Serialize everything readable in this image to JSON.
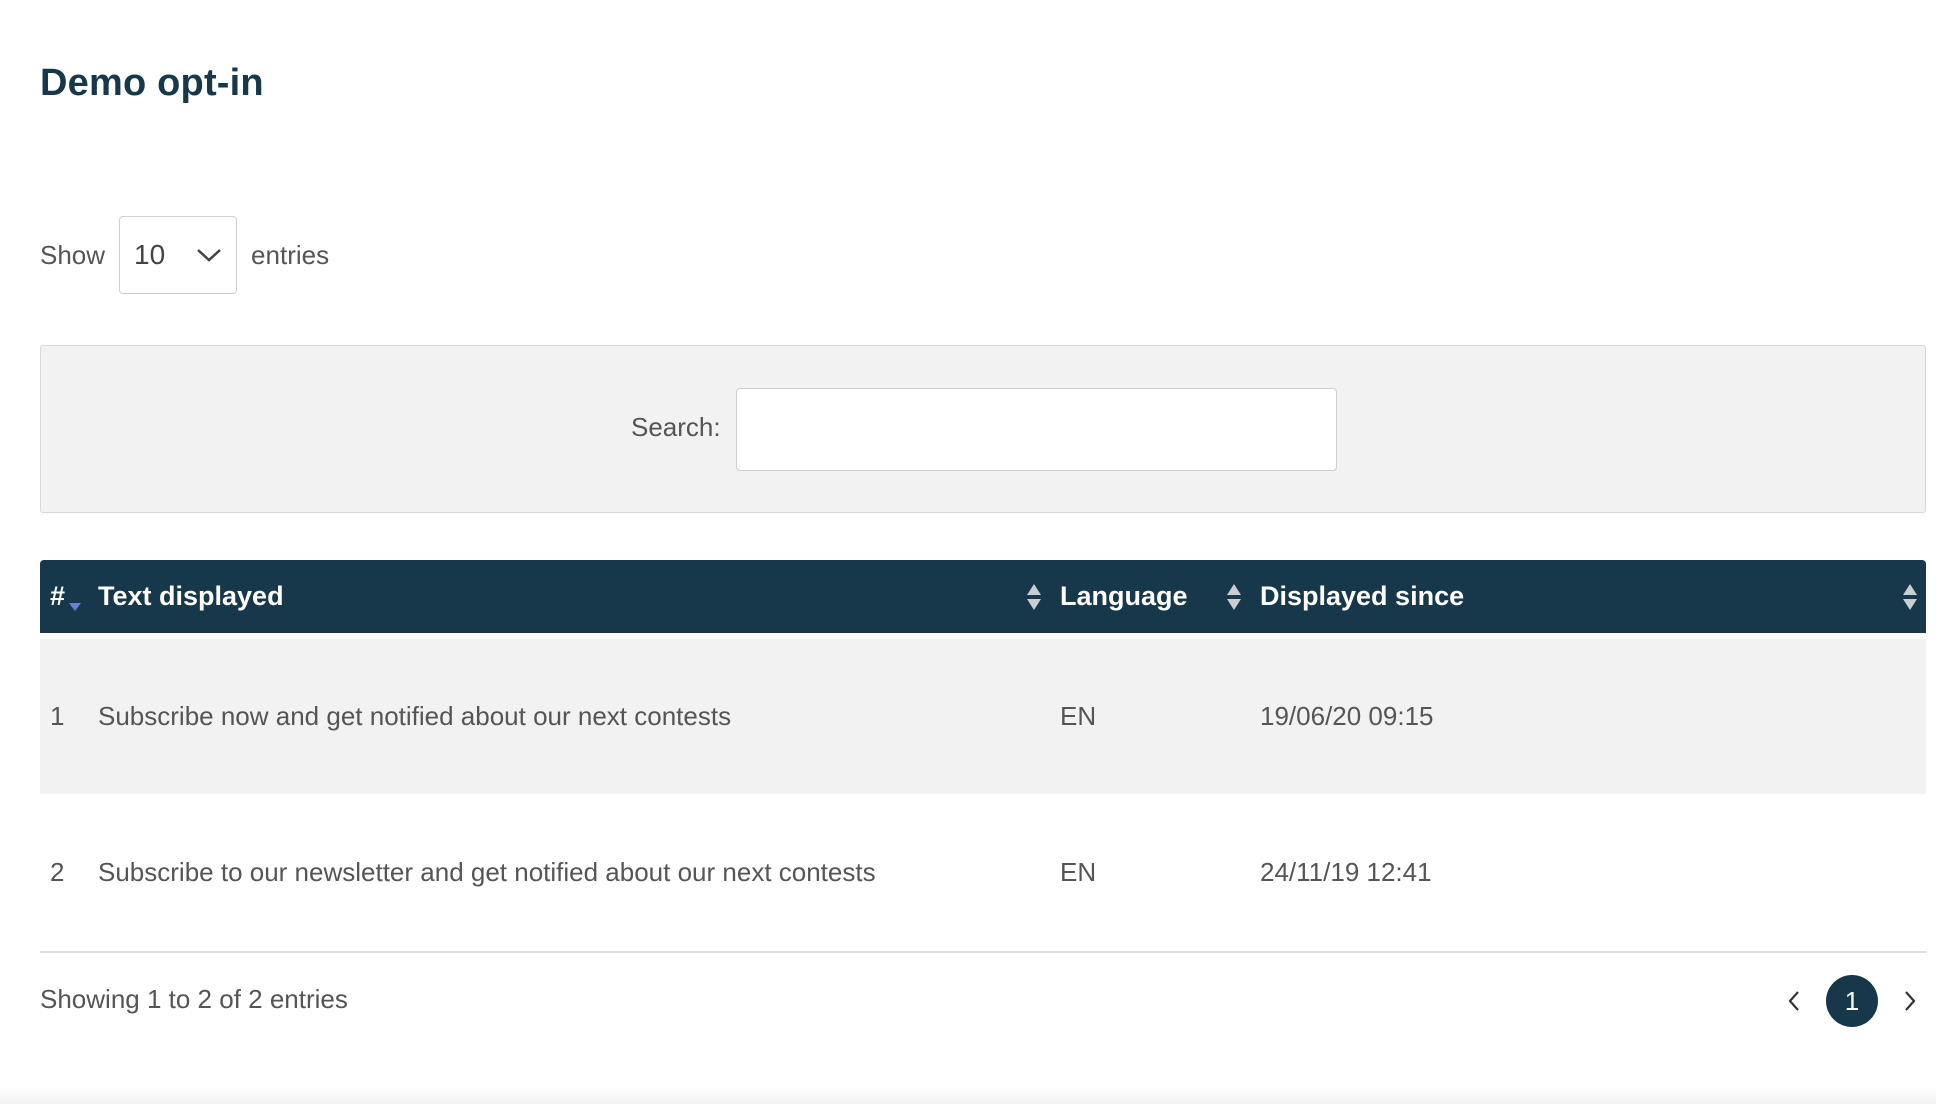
{
  "page": {
    "title": "Demo opt-in"
  },
  "length": {
    "show_label": "Show",
    "selected": "10",
    "entries_label": "entries"
  },
  "search": {
    "label": "Search:",
    "value": ""
  },
  "table": {
    "columns": [
      {
        "label": "#"
      },
      {
        "label": "Text displayed"
      },
      {
        "label": "Language"
      },
      {
        "label": "Displayed since"
      }
    ],
    "rows": [
      {
        "num": "1",
        "text": "Subscribe now and get notified about our next contests",
        "language": "EN",
        "since": "19/06/20 09:15"
      },
      {
        "num": "2",
        "text": "Subscribe to our newsletter and get notified about our next contests",
        "language": "EN",
        "since": "24/11/19 12:41"
      }
    ]
  },
  "info": "Showing 1 to 2 of 2 entries",
  "pagination": {
    "current": "1"
  },
  "colors": {
    "header": "#17374a",
    "stripe": "#f2f2f2",
    "accent": "#17374a"
  },
  "icons": [
    "chevron-down-icon",
    "sort-icon",
    "sort-desc-icon",
    "chevron-left-icon",
    "chevron-right-icon"
  ]
}
